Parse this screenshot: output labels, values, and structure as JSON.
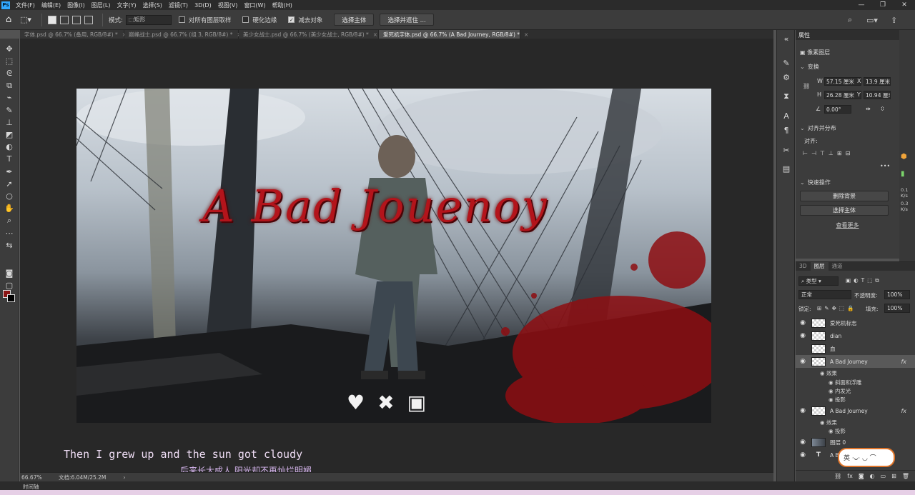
{
  "menubar": {
    "items": [
      "文件(F)",
      "编辑(E)",
      "图像(I)",
      "图层(L)",
      "文字(Y)",
      "选择(S)",
      "滤镜(T)",
      "3D(D)",
      "视图(V)",
      "窗口(W)",
      "帮助(H)"
    ]
  },
  "options": {
    "mode_label": "模式:",
    "mode_value": "矩形",
    "sample_all": "对所有图层取样",
    "hard_edge": "硬化边缘",
    "subtract": "减去对象",
    "select_subject": "选择主体",
    "select_and_mask": "选择并遮住 ..."
  },
  "tabs": [
    {
      "label": "字体.psd @ 66.7% (备用, RGB/8#) *"
    },
    {
      "label": "巅峰战士.psd @ 66.7% (组 3, RGB/8#) *"
    },
    {
      "label": "美少女战士.psd @ 66.7% (美少女战士, RGB/8#) *"
    },
    {
      "label": "爱死机字体.psd @ 66.7% (A Bad Journey, RGB/8#) *"
    }
  ],
  "canvas": {
    "title": "A Bad Jouenoy"
  },
  "subtitles": {
    "english": "Then I grew up and the sun got cloudy",
    "chinese": "后来长大成人 阳光却不再灿烂明媚"
  },
  "status": {
    "zoom": "66.67%",
    "doc": "文档:6.04M/25.2M",
    "timeline": "时间轴"
  },
  "properties": {
    "panel_title": "属性",
    "layer_kind": "像素图层",
    "transform_label": "变换",
    "w_label": "W",
    "w_value": "57.15 厘米",
    "x_label": "X",
    "x_value": "13.9 厘米",
    "h_label": "H",
    "h_value": "26.28 厘米",
    "y_label": "Y",
    "y_value": "10.94 厘米",
    "angle_value": "0.00°",
    "align_label": "对齐并分布",
    "align_sub": "对齐:",
    "quick_label": "快速操作",
    "remove_bg": "删除背景",
    "select_subject": "选择主体",
    "see_more": "查看更多"
  },
  "edge": {
    "v1": "0.1",
    "v1u": "K/s",
    "v2": "0.3",
    "v2u": "K/s"
  },
  "layers": {
    "tab_3d": "3D",
    "tab_layers": "图层",
    "tab_channels": "通道",
    "filter_kind": "类型",
    "blend_mode": "正常",
    "opacity_label": "不透明度:",
    "opacity_value": "100%",
    "lock_label": "锁定:",
    "fill_label": "填充:",
    "fill_value": "100%",
    "rows": [
      {
        "name": "爱死机标志"
      },
      {
        "name": "dian"
      },
      {
        "name": "血"
      },
      {
        "name": "A Bad Journey",
        "fx": "fx"
      },
      {
        "name": "A Bad Journey",
        "fx": "fx"
      },
      {
        "name": "图层 0"
      },
      {
        "name": "A B"
      }
    ],
    "effects1": [
      "效果",
      "斜面和浮雕",
      "内发光",
      "投影"
    ],
    "effects2": [
      "效果",
      "投影"
    ]
  },
  "sticker": {
    "text": "英 ·ᴗ· ◡ ⌒"
  }
}
